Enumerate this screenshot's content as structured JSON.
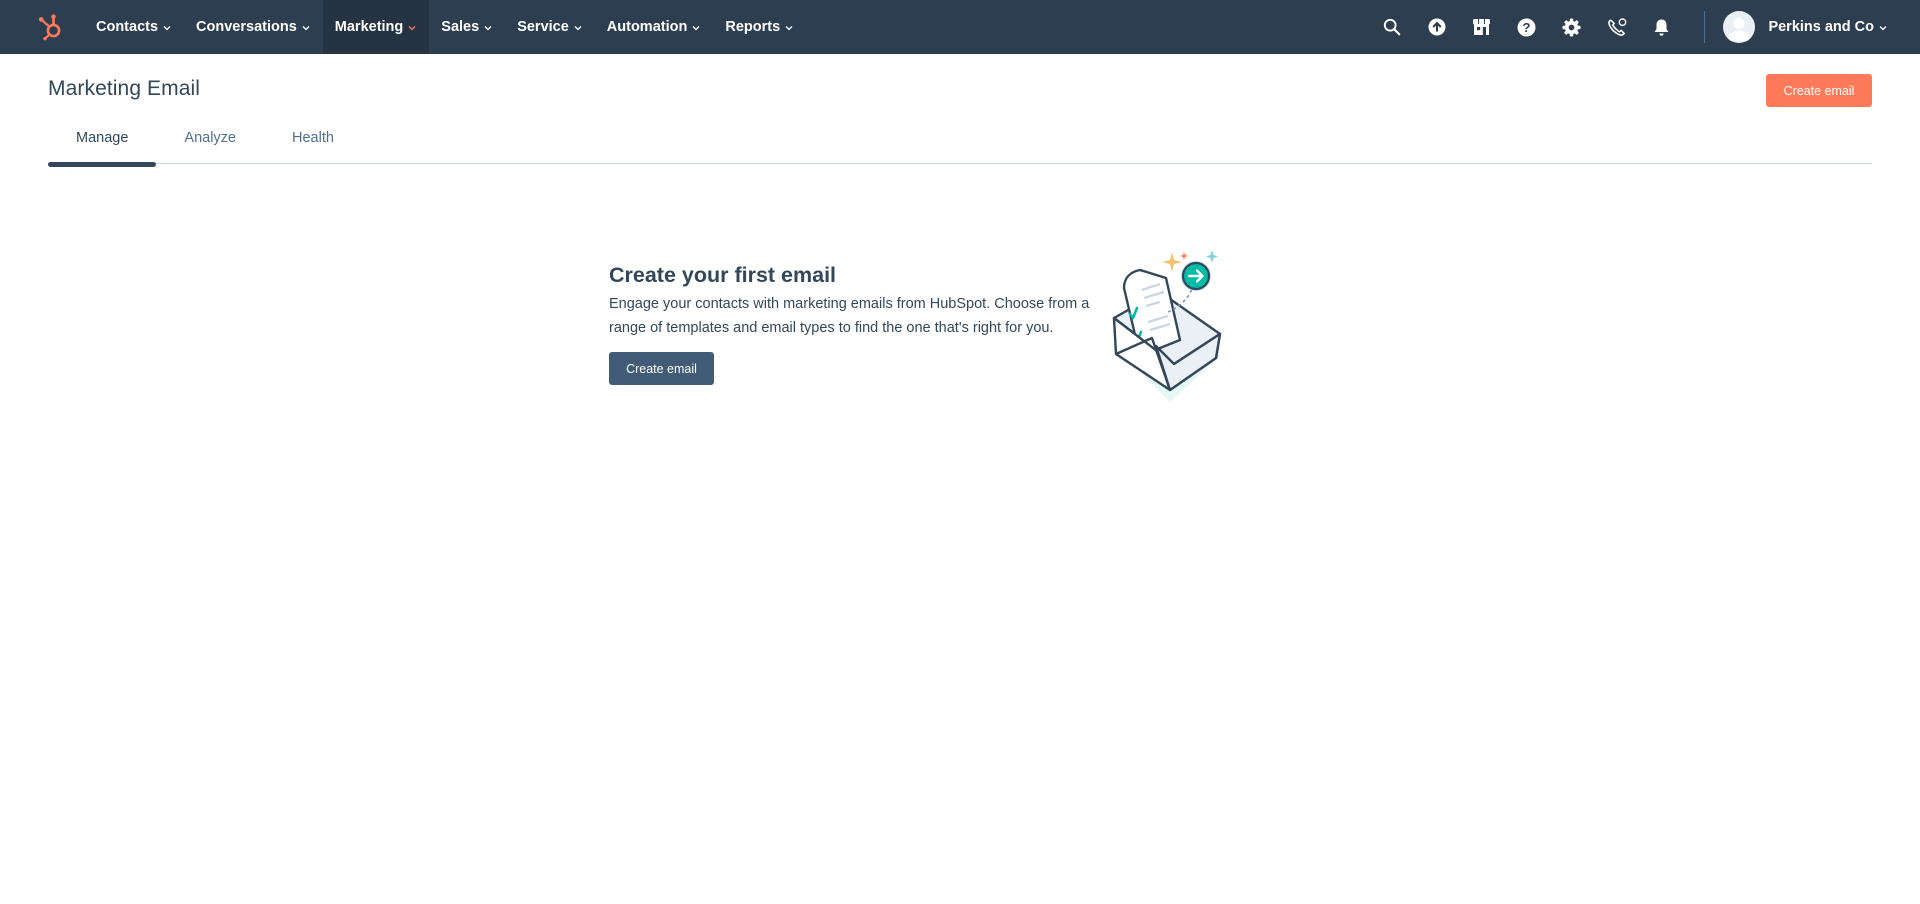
{
  "topnav": {
    "logo_icon": "hubspot-sprocket-icon",
    "menu": [
      {
        "label": "Contacts"
      },
      {
        "label": "Conversations"
      },
      {
        "label": "Marketing"
      },
      {
        "label": "Sales"
      },
      {
        "label": "Service"
      },
      {
        "label": "Automation"
      },
      {
        "label": "Reports"
      }
    ],
    "active_menu": "Marketing",
    "utility_icons": [
      "search-icon",
      "upgrade-icon",
      "marketplace-icon",
      "help-icon",
      "settings-icon",
      "calling-icon",
      "notifications-icon"
    ],
    "account_name": "Perkins and Co"
  },
  "page": {
    "title": "Marketing Email",
    "create_button": "Create email"
  },
  "tabs": [
    {
      "label": "Manage",
      "active": true
    },
    {
      "label": "Analyze",
      "active": false
    },
    {
      "label": "Health",
      "active": false
    }
  ],
  "empty_state": {
    "title": "Create your first email",
    "description": "Engage your contacts with marketing emails from HubSpot. Choose from a range of templates and email types to find the one that's right for you.",
    "button": "Create email",
    "illustration": "email-envelope-illustration"
  },
  "colors": {
    "nav_bg": "#2d3e50",
    "accent_orange": "#ff7a59",
    "secondary_button": "#425b76",
    "text": "#33475b",
    "teal": "#00bda5"
  }
}
